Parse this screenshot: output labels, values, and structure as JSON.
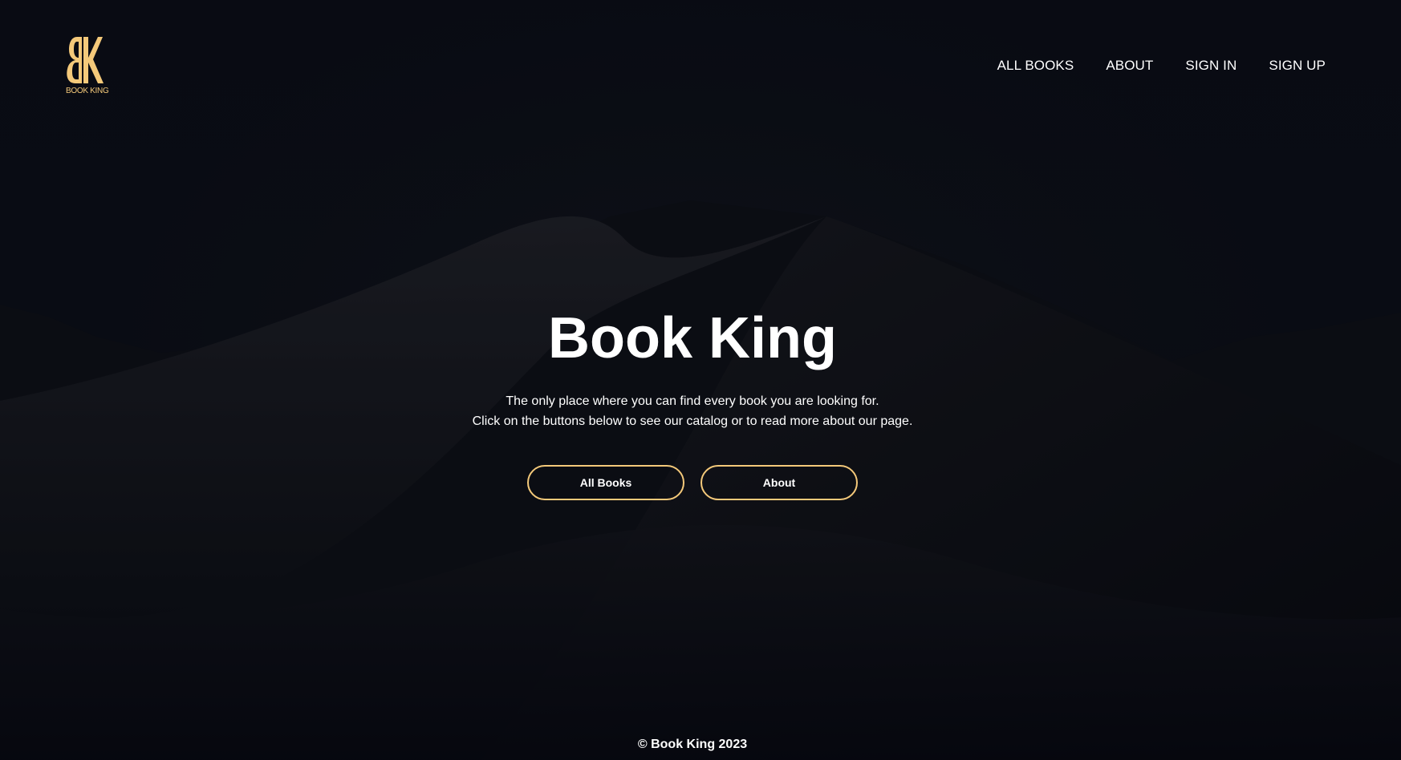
{
  "brand": {
    "logo_text": "BOOK KING",
    "accent_color": "#f4c97a"
  },
  "nav": {
    "items": [
      {
        "label": "ALL BOOKS"
      },
      {
        "label": "ABOUT"
      },
      {
        "label": "SIGN IN"
      },
      {
        "label": "SIGN UP"
      }
    ]
  },
  "hero": {
    "title": "Book King",
    "line1": "The only place where you can find every book you are looking for.",
    "line2": "Click on the buttons below to see our catalog or to read more about our page.",
    "buttons": {
      "all_books": "All Books",
      "about": "About"
    }
  },
  "footer": {
    "copyright": "© Book King 2023"
  }
}
